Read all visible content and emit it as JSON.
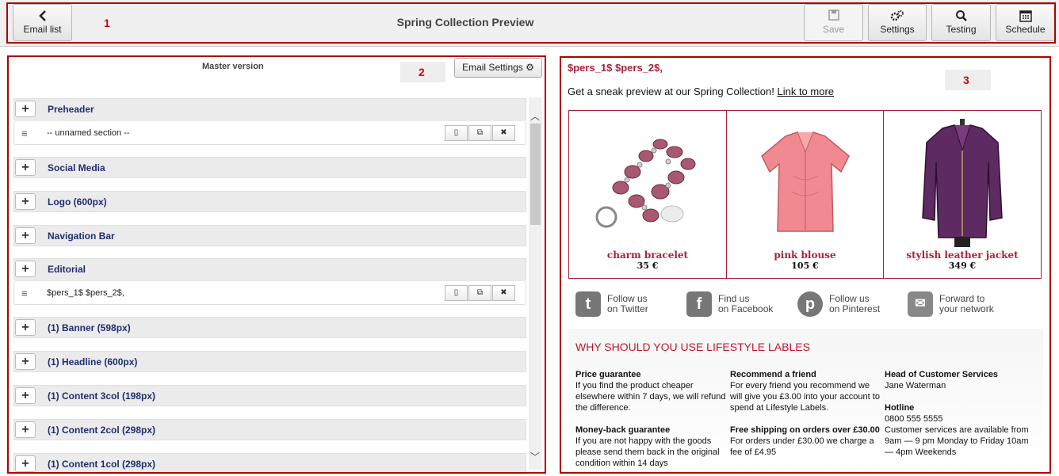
{
  "toolbar": {
    "back_label": "Email list",
    "title": "Spring Collection Preview",
    "save_label": "Save",
    "settings_label": "Settings",
    "testing_label": "Testing",
    "schedule_label": "Schedule"
  },
  "annotations": [
    "1",
    "2",
    "3"
  ],
  "editor": {
    "version_label": "Master version",
    "email_settings_label": "Email Settings",
    "sections": [
      {
        "title": "Preheader",
        "subrow": "-- unnamed section --"
      },
      {
        "title": "Social Media"
      },
      {
        "title": "Logo (600px)"
      },
      {
        "title": "Navigation Bar"
      },
      {
        "title": "Editorial",
        "subrow": "$pers_1$ $pers_2$,"
      },
      {
        "title": "(1) Banner (598px)"
      },
      {
        "title": "(1) Headline (600px)"
      },
      {
        "title": "(1) Content 3col (198px)"
      },
      {
        "title": "(1) Content 2col (298px)"
      },
      {
        "title": "(1) Content 1col (298px)"
      }
    ]
  },
  "preview": {
    "greeting": "$pers_1$ $pers_2$,",
    "teaser": "Get a sneak preview at our Spring Collection!",
    "teaser_link": "Link to more",
    "products": [
      {
        "name": "charm bracelet",
        "price": "35 €"
      },
      {
        "name": "pink blouse",
        "price": "105 €"
      },
      {
        "name": "stylish leather jacket",
        "price": "349 €"
      }
    ],
    "social": [
      {
        "line1": "Follow us",
        "line2": "on Twitter",
        "icon": "twitter-icon"
      },
      {
        "line1": "Find us",
        "line2": "on Facebook",
        "icon": "facebook-icon"
      },
      {
        "line1": "Follow us",
        "line2": "on Pinterest",
        "icon": "pinterest-icon"
      },
      {
        "line1": "Forward to",
        "line2": "your network",
        "icon": "forward-mail-icon"
      }
    ],
    "why_title": "WHY SHOULD YOU USE LIFESTYLE LABLES",
    "benefits": [
      {
        "title": "Price guarantee",
        "text": "If you find the product cheaper elsewhere within 7 days, we will refund the difference."
      },
      {
        "title": "Money-back guarantee",
        "text": "If you are not happy with the goods please send them back in the original condition within 14 days"
      },
      {
        "title": "Recommend a friend",
        "text": "For every friend you recommend we will give you £3.00 into your account to spend at Lifestyle Labels."
      },
      {
        "title": "Free shipping on orders over £30.00",
        "text": "For orders under £30.00 we charge a fee of £4.95"
      },
      {
        "title": "Head of Customer Services",
        "text": "Jane Waterman"
      },
      {
        "title": "Hotline",
        "text": "0800 555 5555\nCustomer services are available from 9am — 9 pm Monday to Friday 10am — 4pm Weekends"
      }
    ]
  },
  "colors": {
    "accent_red": "#a8233a",
    "annotation_red": "#b00000",
    "section_title": "#1f2f6e"
  }
}
